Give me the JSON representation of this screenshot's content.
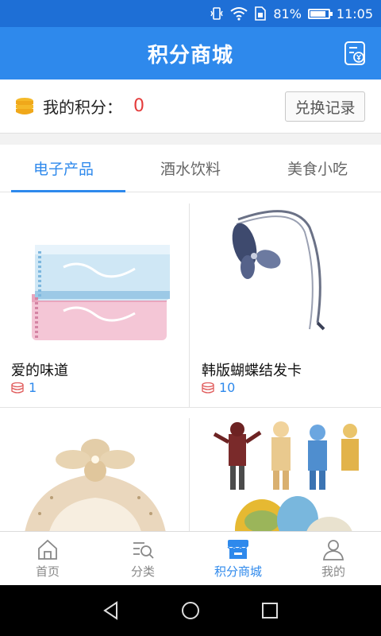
{
  "status_bar": {
    "battery": "81%",
    "time": "11:05",
    "battery_level": 0.81
  },
  "header": {
    "title": "积分商城",
    "receipt_icon": "receipt-yen-icon"
  },
  "points": {
    "label": "我的积分：",
    "value": "0",
    "exchange_button": "兑换记录",
    "coin_icon": "coin-stack-icon"
  },
  "tabs": [
    {
      "label": "电子产品",
      "active": true
    },
    {
      "label": "酒水饮料",
      "active": false
    },
    {
      "label": "美食小吃",
      "active": false
    }
  ],
  "products": [
    {
      "name": "爱的味道",
      "price": "1"
    },
    {
      "name": "韩版蝴蝶结发卡",
      "price": "10"
    },
    {
      "name": "",
      "price": ""
    },
    {
      "name": "",
      "price": ""
    }
  ],
  "bottom_nav": [
    {
      "label": "首页",
      "icon": "home-icon",
      "active": false
    },
    {
      "label": "分类",
      "icon": "category-search-icon",
      "active": false
    },
    {
      "label": "积分商城",
      "icon": "store-icon",
      "active": true
    },
    {
      "label": "我的",
      "icon": "person-icon",
      "active": false
    }
  ],
  "colors": {
    "primary": "#2e89ec",
    "status_bar": "#1e6fd6",
    "points_value": "#e43b3b"
  }
}
